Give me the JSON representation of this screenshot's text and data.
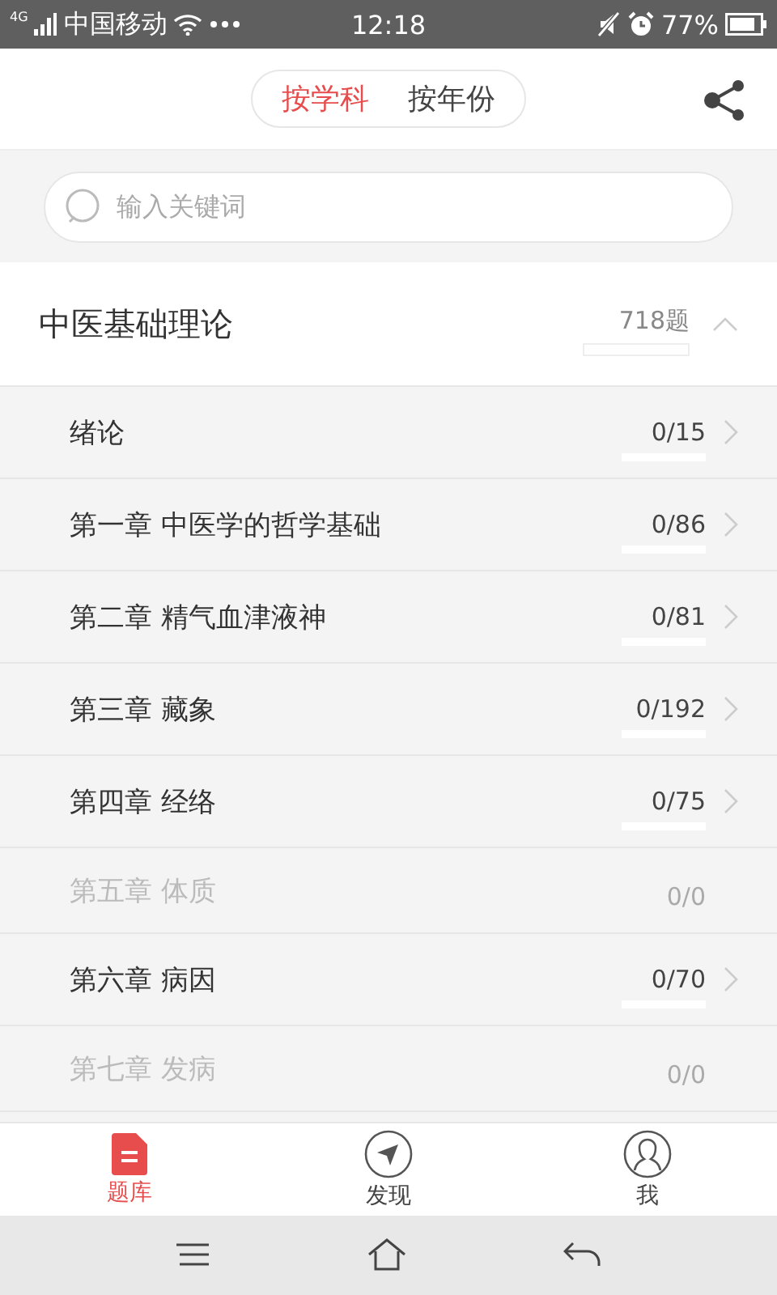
{
  "status_bar": {
    "network": "4G",
    "carrier": "中国移动",
    "time": "12:18",
    "battery": "77%"
  },
  "header": {
    "tabs": [
      {
        "label": "按学科",
        "selected": true
      },
      {
        "label": "按年份",
        "selected": false
      }
    ]
  },
  "search": {
    "placeholder": "输入关键词"
  },
  "category": {
    "title": "中医基础理论",
    "count": "718题",
    "expanded": true
  },
  "chapters": [
    {
      "title": "绪论",
      "progress": "0/15",
      "disabled": false
    },
    {
      "title": "第一章 中医学的哲学基础",
      "progress": "0/86",
      "disabled": false
    },
    {
      "title": "第二章 精气血津液神",
      "progress": "0/81",
      "disabled": false
    },
    {
      "title": "第三章 藏象",
      "progress": "0/192",
      "disabled": false
    },
    {
      "title": "第四章 经络",
      "progress": "0/75",
      "disabled": false
    },
    {
      "title": "第五章 体质",
      "progress": "0/0",
      "disabled": true
    },
    {
      "title": "第六章 病因",
      "progress": "0/70",
      "disabled": false
    },
    {
      "title": "第七章 发病",
      "progress": "0/0",
      "disabled": true
    }
  ],
  "bottom_tabs": [
    {
      "label": "题库",
      "kind": "doc",
      "selected": true
    },
    {
      "label": "发现",
      "kind": "compass",
      "selected": false
    },
    {
      "label": "我",
      "kind": "user",
      "selected": false
    }
  ]
}
